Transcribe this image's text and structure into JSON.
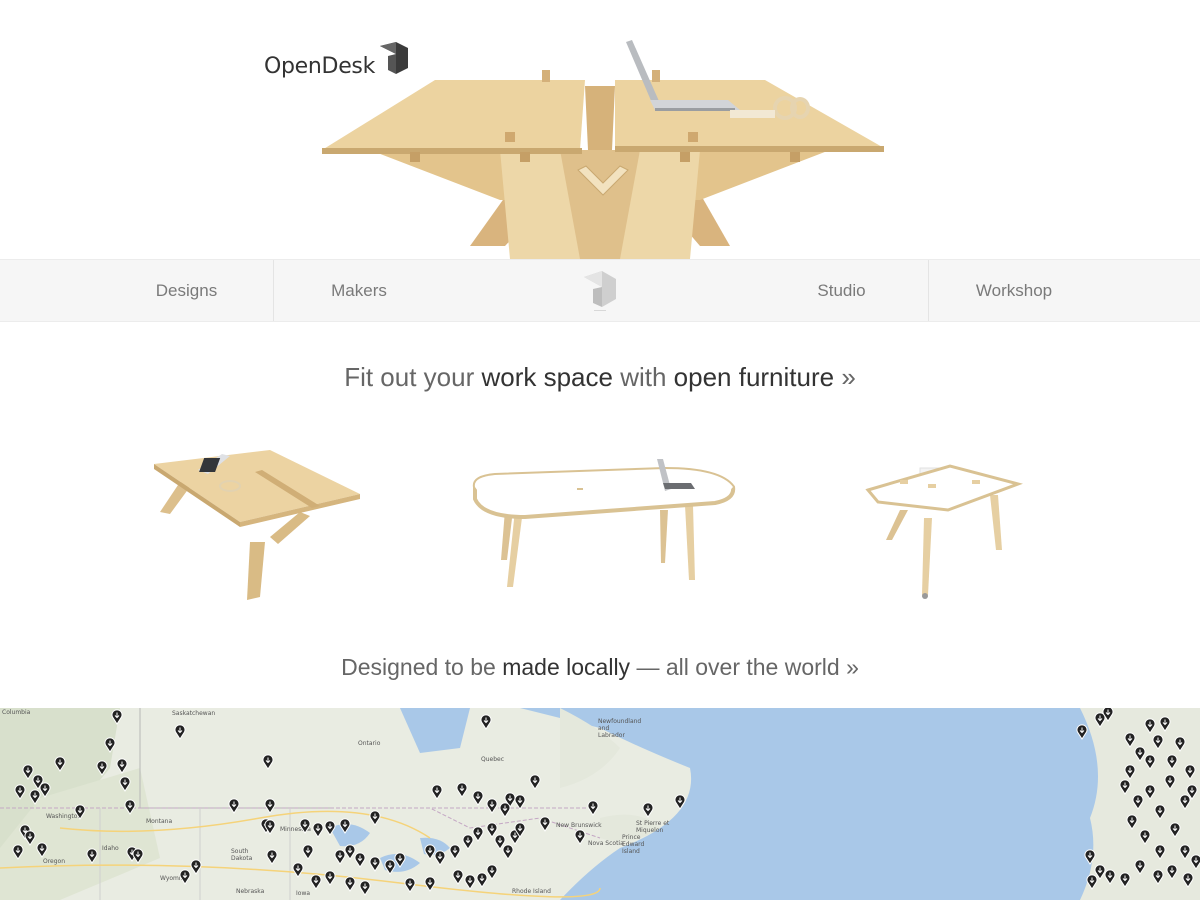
{
  "brand": {
    "name": "OpenDesk"
  },
  "nav": {
    "items": [
      {
        "label": "Designs"
      },
      {
        "label": "Makers"
      },
      {
        "label": "Studio"
      },
      {
        "label": "Workshop"
      }
    ]
  },
  "headline_1": {
    "parts": [
      "Fit out your ",
      "work space",
      " with ",
      "open furniture",
      " »"
    ]
  },
  "headline_2": {
    "parts": [
      "Designed to be ",
      "made locally",
      " — all over the world »"
    ]
  },
  "products": [
    {
      "name": "plywood-desk"
    },
    {
      "name": "white-meeting-table"
    },
    {
      "name": "white-triangle-table"
    }
  ],
  "map": {
    "labels": [
      "Columbia",
      "Saskatchewan",
      "Newfoundland and Labrador",
      "Ontario",
      "Quebec",
      "Washington",
      "Montana",
      "Oregon",
      "Idaho",
      "South Dakota",
      "Wyoming",
      "Nebraska",
      "Minnesota",
      "Nova Scotia",
      "Prince Edward Island",
      "New Brunswick",
      "Rhode Island",
      "Iowa",
      "St Pierre et Miquelon"
    ]
  },
  "colors": {
    "wood": "#e9cf9d",
    "wood_dark": "#c9a870",
    "nav_bg": "#f6f6f6",
    "map_land": "#e8ebe0",
    "map_marker": "#222222"
  }
}
